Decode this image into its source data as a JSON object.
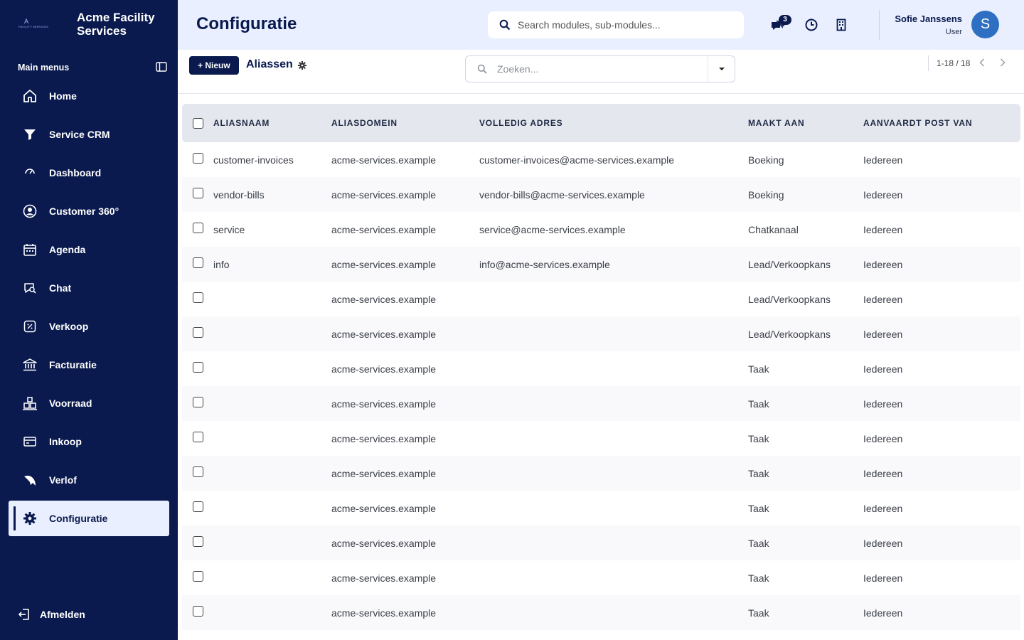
{
  "brand": {
    "logo_line1": "A",
    "logo_line2": "FACILITY SERVICES",
    "name": "Acme Facility Services"
  },
  "sidebar": {
    "section_label": "Main menus",
    "items": [
      {
        "label": "Home",
        "icon": "home-icon"
      },
      {
        "label": "Service CRM",
        "icon": "funnel-icon"
      },
      {
        "label": "Dashboard",
        "icon": "gauge-icon"
      },
      {
        "label": "Customer 360°",
        "icon": "user-circle-icon"
      },
      {
        "label": "Agenda",
        "icon": "calendar-icon"
      },
      {
        "label": "Chat",
        "icon": "chat-search-icon"
      },
      {
        "label": "Verkoop",
        "icon": "percent-tag-icon"
      },
      {
        "label": "Facturatie",
        "icon": "bank-icon"
      },
      {
        "label": "Voorraad",
        "icon": "warehouse-icon"
      },
      {
        "label": "Inkoop",
        "icon": "card-icon"
      },
      {
        "label": "Verlof",
        "icon": "plane-icon"
      },
      {
        "label": "Configuratie",
        "icon": "gear-icon",
        "active": true
      }
    ],
    "logout_label": "Afmelden"
  },
  "header": {
    "title": "Configuratie",
    "search_placeholder": "Search modules, sub-modules...",
    "chat_badge": "3",
    "user_name": "Sofie Janssens",
    "user_role": "User",
    "avatar_initial": "S"
  },
  "controls": {
    "new_label": "+ Nieuw",
    "breadcrumb": "Aliassen",
    "search_placeholder": "Zoeken...",
    "pager": "1-18 / 18"
  },
  "table": {
    "columns": [
      "ALIASNAAM",
      "ALIASDOMEIN",
      "VOLLEDIG ADRES",
      "MAAKT AAN",
      "AANVAARDT POST VAN"
    ],
    "rows": [
      [
        "customer-invoices",
        "acme-services.example",
        "customer-invoices@acme-services.example",
        "Boeking",
        "Iedereen"
      ],
      [
        "vendor-bills",
        "acme-services.example",
        "vendor-bills@acme-services.example",
        "Boeking",
        "Iedereen"
      ],
      [
        "service",
        "acme-services.example",
        "service@acme-services.example",
        "Chatkanaal",
        "Iedereen"
      ],
      [
        "info",
        "acme-services.example",
        "info@acme-services.example",
        "Lead/Verkoopkans",
        "Iedereen"
      ],
      [
        "",
        "acme-services.example",
        "",
        "Lead/Verkoopkans",
        "Iedereen"
      ],
      [
        "",
        "acme-services.example",
        "",
        "Lead/Verkoopkans",
        "Iedereen"
      ],
      [
        "",
        "acme-services.example",
        "",
        "Taak",
        "Iedereen"
      ],
      [
        "",
        "acme-services.example",
        "",
        "Taak",
        "Iedereen"
      ],
      [
        "",
        "acme-services.example",
        "",
        "Taak",
        "Iedereen"
      ],
      [
        "",
        "acme-services.example",
        "",
        "Taak",
        "Iedereen"
      ],
      [
        "",
        "acme-services.example",
        "",
        "Taak",
        "Iedereen"
      ],
      [
        "",
        "acme-services.example",
        "",
        "Taak",
        "Iedereen"
      ],
      [
        "",
        "acme-services.example",
        "",
        "Taak",
        "Iedereen"
      ],
      [
        "",
        "acme-services.example",
        "",
        "Taak",
        "Iedereen"
      ]
    ]
  },
  "colors": {
    "sidebar_bg": "#0a1a4e",
    "header_bg": "#e9efff",
    "accent": "#0a1a4e",
    "avatar": "#2e6fc2"
  }
}
